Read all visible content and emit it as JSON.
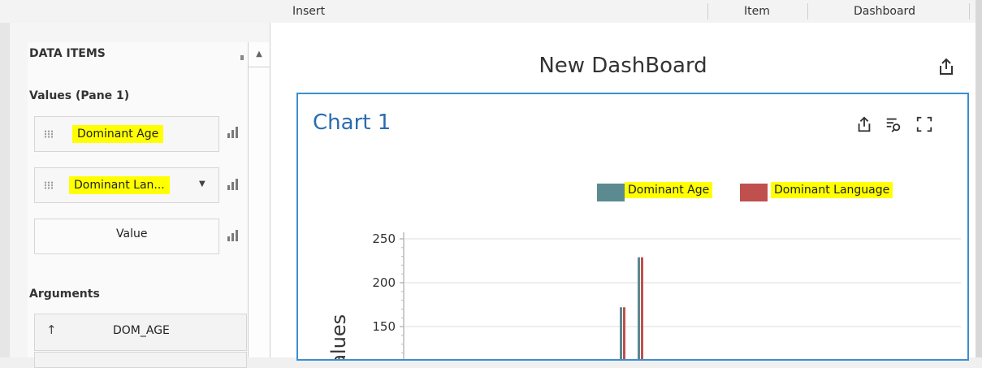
{
  "ribbon": {
    "tabs": [
      "Insert",
      "Item",
      "Dashboard"
    ]
  },
  "panel": {
    "header": "DATA ITEMS",
    "values_section": "Values (Pane 1)",
    "fields": [
      {
        "label": "Dominant Age",
        "highlighted": true
      },
      {
        "label": "Dominant Lan...",
        "highlighted": true,
        "has_dropdown": true
      },
      {
        "label": "Value",
        "highlighted": false
      }
    ],
    "arguments_section": "Arguments",
    "arguments": [
      {
        "label": "DOM_AGE",
        "sort_icon": "sort-ascending-arrow-icon"
      }
    ]
  },
  "dashboard": {
    "title": "New DashBoard",
    "export_icon": "export-icon"
  },
  "chart_card": {
    "title": "Chart 1",
    "icons": [
      "export-icon",
      "filter-search-icon",
      "maximize-icon"
    ]
  },
  "chart_data": {
    "type": "bar",
    "title": "Chart 1",
    "ylabel": "Values",
    "ylim": [
      100,
      250
    ],
    "yticks": [
      150,
      200,
      250
    ],
    "grid": true,
    "legend_position": "top-right",
    "series": [
      {
        "name": "Dominant Age",
        "color": "#5b8a91"
      },
      {
        "name": "Dominant Language",
        "color": "#c0504d"
      }
    ],
    "visible_values": [
      {
        "series": [
          172,
          172
        ]
      },
      {
        "series": [
          229,
          229
        ]
      }
    ]
  },
  "colors": {
    "accent": "#3a8fd0",
    "highlight": "#ffff00",
    "title_blue": "#2b6cb0"
  }
}
